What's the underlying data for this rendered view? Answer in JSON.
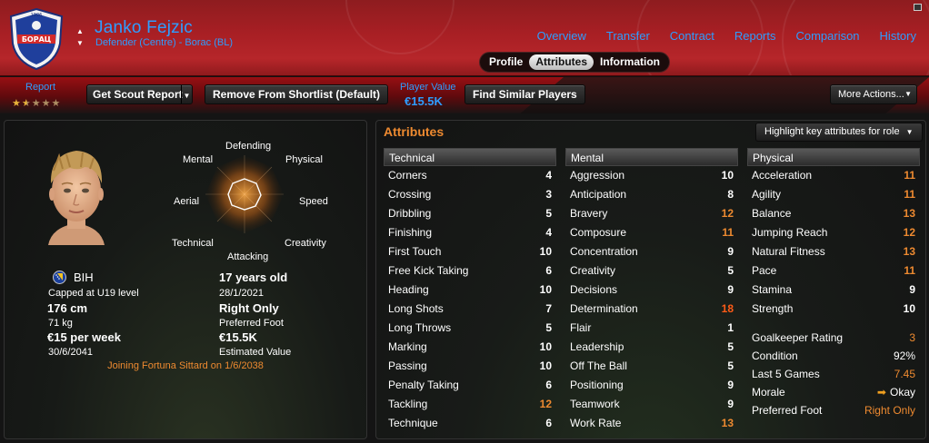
{
  "header": {
    "player_name": "Janko Fejzic",
    "player_role": "Defender (Centre) - Borac (BL)",
    "crest_text": "БОРАЦ",
    "crest_year": "1926",
    "nav": [
      "Overview",
      "Transfer",
      "Contract",
      "Reports",
      "Comparison",
      "History"
    ],
    "subtabs": [
      "Profile",
      "Attributes",
      "Information"
    ],
    "active_subtab": "Attributes"
  },
  "toolbar": {
    "report_label": "Report",
    "report_stars": 1.5,
    "report_stars_max": 5,
    "get_scout_report": "Get Scout Report",
    "remove_shortlist": "Remove From Shortlist (Default)",
    "player_value_label": "Player Value",
    "player_value": "€15.5K",
    "find_similar": "Find Similar Players",
    "more_actions": "More Actions..."
  },
  "profile": {
    "radar_labels": {
      "defending": "Defending",
      "physical": "Physical",
      "speed": "Speed",
      "creativity": "Creativity",
      "attacking": "Attacking",
      "technical": "Technical",
      "aerial": "Aerial",
      "mental": "Mental"
    },
    "nationality": "BIH",
    "caps": "Capped at U19 level",
    "height": "176 cm",
    "weight": "71 kg",
    "wage": "€15 per week",
    "contract_end": "30/6/2041",
    "age": "17 years old",
    "dob": "28/1/2021",
    "foot": "Right Only",
    "foot_label": "Preferred Foot",
    "value": "€15.5K",
    "value_label": "Estimated Value",
    "joining": "Joining Fortuna Sittard on 1/6/2038"
  },
  "attributes": {
    "title": "Attributes",
    "highlight_button": "Highlight key attributes for role",
    "technical": {
      "header": "Technical",
      "items": [
        {
          "name": "Corners",
          "value": "4"
        },
        {
          "name": "Crossing",
          "value": "3"
        },
        {
          "name": "Dribbling",
          "value": "5"
        },
        {
          "name": "Finishing",
          "value": "4"
        },
        {
          "name": "First Touch",
          "value": "10"
        },
        {
          "name": "Free Kick Taking",
          "value": "6"
        },
        {
          "name": "Heading",
          "value": "10"
        },
        {
          "name": "Long Shots",
          "value": "7"
        },
        {
          "name": "Long Throws",
          "value": "5"
        },
        {
          "name": "Marking",
          "value": "10"
        },
        {
          "name": "Passing",
          "value": "10"
        },
        {
          "name": "Penalty Taking",
          "value": "6"
        },
        {
          "name": "Tackling",
          "value": "12"
        },
        {
          "name": "Technique",
          "value": "6"
        }
      ]
    },
    "mental": {
      "header": "Mental",
      "items": [
        {
          "name": "Aggression",
          "value": "10"
        },
        {
          "name": "Anticipation",
          "value": "8"
        },
        {
          "name": "Bravery",
          "value": "12"
        },
        {
          "name": "Composure",
          "value": "11"
        },
        {
          "name": "Concentration",
          "value": "9"
        },
        {
          "name": "Creativity",
          "value": "5"
        },
        {
          "name": "Decisions",
          "value": "9"
        },
        {
          "name": "Determination",
          "value": "18"
        },
        {
          "name": "Flair",
          "value": "1"
        },
        {
          "name": "Leadership",
          "value": "5"
        },
        {
          "name": "Off The Ball",
          "value": "5"
        },
        {
          "name": "Positioning",
          "value": "9"
        },
        {
          "name": "Teamwork",
          "value": "9"
        },
        {
          "name": "Work Rate",
          "value": "13"
        }
      ]
    },
    "physical": {
      "header": "Physical",
      "items": [
        {
          "name": "Acceleration",
          "value": "11"
        },
        {
          "name": "Agility",
          "value": "11"
        },
        {
          "name": "Balance",
          "value": "13"
        },
        {
          "name": "Jumping Reach",
          "value": "12"
        },
        {
          "name": "Natural Fitness",
          "value": "13"
        },
        {
          "name": "Pace",
          "value": "11"
        },
        {
          "name": "Stamina",
          "value": "9"
        },
        {
          "name": "Strength",
          "value": "10"
        }
      ]
    },
    "extra": [
      {
        "name": "Goalkeeper Rating",
        "value": "3"
      },
      {
        "name": "Condition",
        "value": "92%"
      },
      {
        "name": "Last 5 Games",
        "value": "7.45"
      },
      {
        "name": "Morale",
        "value": "Okay"
      },
      {
        "name": "Preferred Foot",
        "value": "Right Only"
      }
    ]
  }
}
